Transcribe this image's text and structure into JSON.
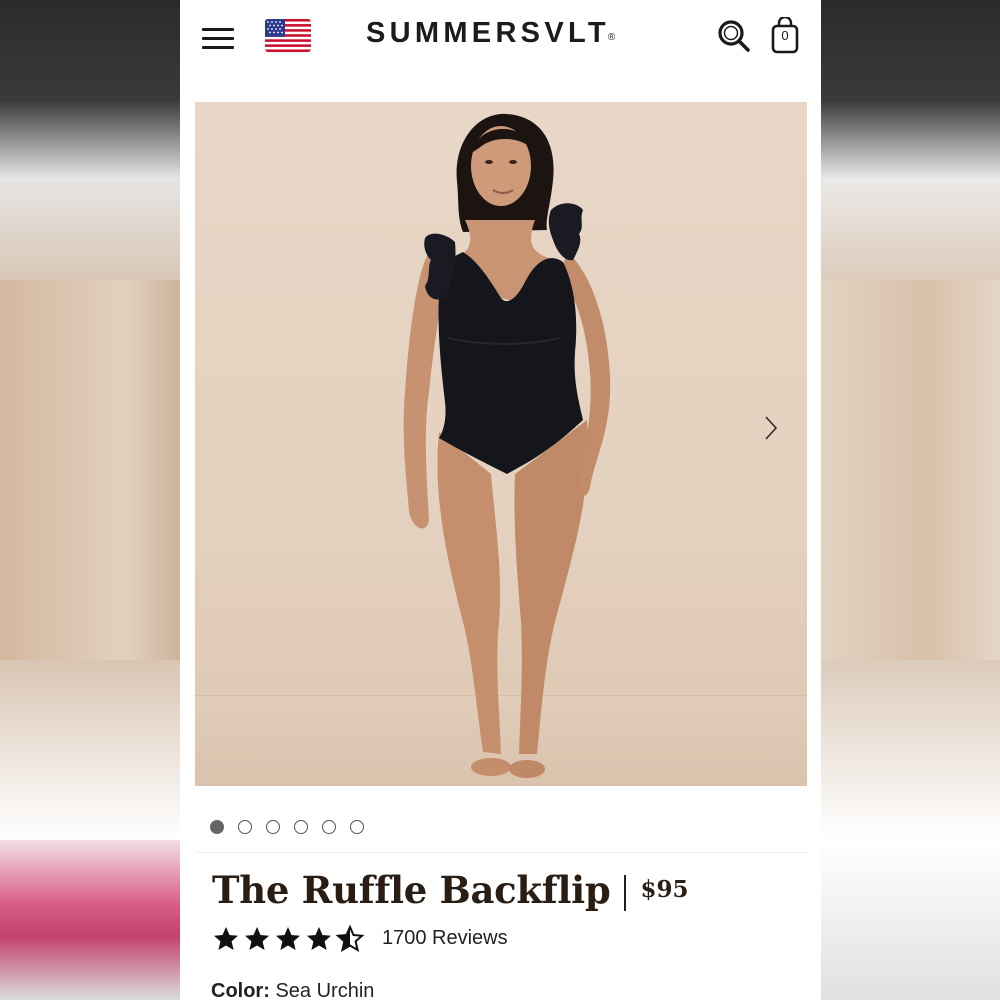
{
  "header": {
    "brand": "SUMMERSVLT",
    "brand_mark": "®",
    "cart_count": "0"
  },
  "icons": {
    "menu": "hamburger-icon",
    "region": "us-flag-icon",
    "search": "search-icon",
    "cart": "shopping-bag-icon",
    "carousel_next": "chevron-right-icon"
  },
  "gallery": {
    "image_count": 6,
    "active_index": 0
  },
  "product": {
    "title": "The Ruffle Backflip",
    "price": "$95",
    "rating": 4.5,
    "rating_max": 5,
    "reviews_text": "1700 Reviews",
    "color_label": "Color:",
    "color_value": "Sea Urchin"
  },
  "colors": {
    "brand_text": "#1b1b1b",
    "title_text": "#2a1e14",
    "swimsuit": "#15161c",
    "backdrop": "#e6d4c3"
  }
}
